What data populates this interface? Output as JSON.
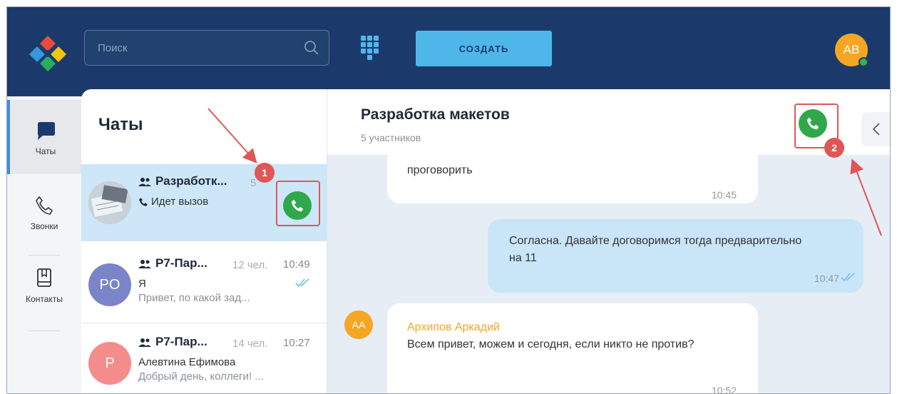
{
  "header": {
    "search_placeholder": "Поиск",
    "create_label": "СОЗДАТЬ",
    "user_initials": "AB",
    "colors": {
      "bar": "#1b3a6b",
      "create": "#4fb6ea",
      "avatar": "#f5a623"
    }
  },
  "nav": {
    "chats": "Чаты",
    "calls": "Звонки",
    "contacts": "Контакты"
  },
  "chat_list": {
    "title": "Чаты",
    "rows": [
      {
        "title": "Разработк...",
        "members": "5",
        "status": "Идет вызов"
      },
      {
        "initials": "PO",
        "title": "Р7-Пар...",
        "members": "12 чел.",
        "time": "10:49",
        "sender": "Я",
        "preview": "Привет, по какой зад...",
        "avatar_color": "#7b84c9"
      },
      {
        "initials": "P",
        "title": "Р7-Пар...",
        "members": "14 чел.",
        "time": "10:27",
        "sender": "Алевтина Ефимова",
        "preview": "Добрый день, коллеги! ...",
        "avatar_color": "#f48c8c"
      }
    ]
  },
  "chat": {
    "title": "Разработка макетов",
    "members": "5 участников",
    "messages": [
      {
        "text": "проговорить",
        "time": "10:45"
      },
      {
        "text": "Согласна. Давайте договоримся тогда предварительно на 11",
        "time": "10:47"
      },
      {
        "avatar": "AA",
        "sender": "Архипов Аркадий",
        "text": "Всем привет, можем и сегодня, если никто не против?",
        "time": "10:52"
      }
    ]
  },
  "annotations": {
    "badge1": "1",
    "badge2": "2",
    "color": "#e05656"
  }
}
